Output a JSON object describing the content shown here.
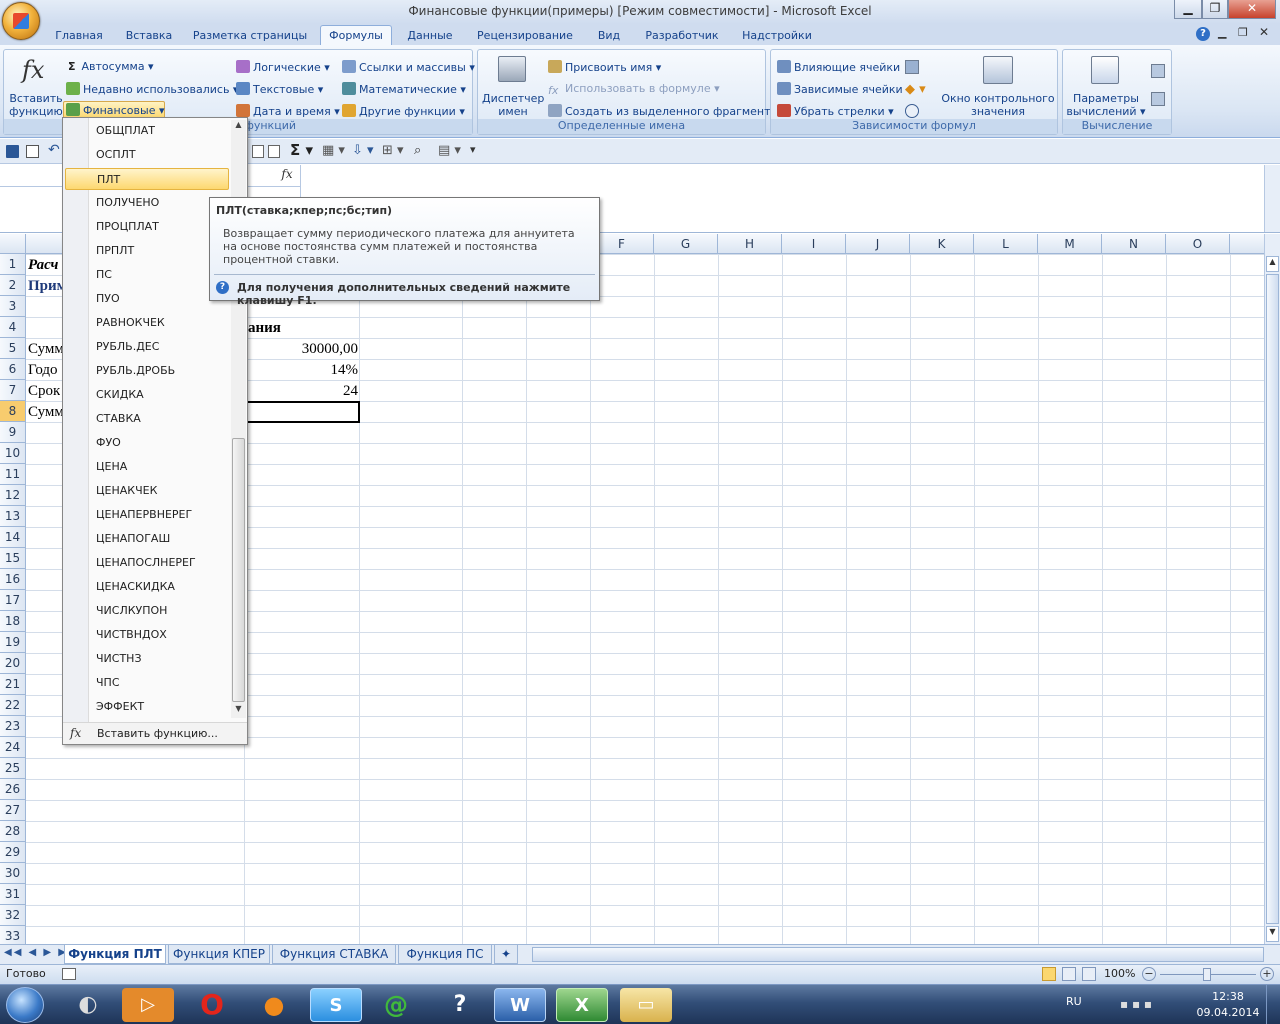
{
  "window": {
    "title": "Финансовые функции(примеры)  [Режим совместимости] - Microsoft Excel"
  },
  "ribbon_tabs": [
    "Главная",
    "Вставка",
    "Разметка страницы",
    "Формулы",
    "Данные",
    "Рецензирование",
    "Вид",
    "Разработчик",
    "Надстройки"
  ],
  "ribbon": {
    "insert_function": "Вставить функцию",
    "autosum": "Автосумма",
    "recent": "Недавно использовались",
    "financial": "Финансовые",
    "logical": "Логические",
    "text": "Текстовые",
    "datetime": "Дата и время",
    "lookup": "Ссылки и массивы",
    "math": "Математические",
    "other": "Другие функции",
    "library_label": "функций",
    "name_manager": "Диспетчер имен",
    "define_name": "Присвоить имя",
    "use_in_formula": "Использовать в формуле",
    "create_from_selection": "Создать из выделенного фрагмента",
    "defined_names_label": "Определенные имена",
    "trace_precedents": "Влияющие ячейки",
    "trace_dependents": "Зависимые ячейки",
    "remove_arrows": "Убрать стрелки",
    "watch_window": "Окно контрольного значения",
    "formula_auditing_label": "Зависимости формул",
    "calc_options": "Параметры вычислений",
    "calculation_label": "Вычисление"
  },
  "formula_bar": {
    "fx": "fx"
  },
  "columns": [
    "F",
    "G",
    "H",
    "I",
    "J",
    "K",
    "L",
    "M",
    "N",
    "O"
  ],
  "rows": [
    "1",
    "2",
    "3",
    "4",
    "5",
    "6",
    "7",
    "8",
    "9",
    "10",
    "11",
    "12",
    "13",
    "14",
    "15",
    "16",
    "17",
    "18",
    "19",
    "20",
    "21",
    "22",
    "23",
    "24",
    "25",
    "26",
    "27",
    "28",
    "29",
    "30",
    "31",
    "32",
    "33"
  ],
  "cells": {
    "a1": "Расч",
    "a2": "Прим",
    "d4": "ания",
    "a5": "Сумм",
    "c5": "30000,00",
    "a6": "Годо",
    "c6": "14%",
    "a7": "Срок",
    "c7": "24",
    "a8": "Сумм"
  },
  "financial_menu": {
    "items": [
      "ОБЩПЛАТ",
      "ОСПЛТ",
      "ПЛТ",
      "ПОЛУЧЕНО",
      "ПРОЦПЛАТ",
      "ПРПЛТ",
      "ПС",
      "ПУО",
      "РАВНОКЧЕК",
      "РУБЛЬ.ДЕС",
      "РУБЛЬ.ДРОБЬ",
      "СКИДКА",
      "СТАВКА",
      "ФУО",
      "ЦЕНА",
      "ЦЕНАКЧЕК",
      "ЦЕНАПЕРВНЕРЕГ",
      "ЦЕНАПОГАШ",
      "ЦЕНАПОСЛНЕРЕГ",
      "ЦЕНАСКИДКА",
      "ЧИСЛКУПОН",
      "ЧИСТВНДОХ",
      "ЧИСТНЗ",
      "ЧПС",
      "ЭФФЕКТ"
    ],
    "footer": "Вставить функцию..."
  },
  "tooltip": {
    "title": "ПЛТ(ставка;кпер;пс;бс;тип)",
    "body": "Возвращает сумму периодического платежа для аннуитета на основе постоянства сумм платежей и постоянства процентной ставки.",
    "help": "Для получения дополнительных сведений нажмите клавишу F1."
  },
  "sheets": [
    "Функция ПЛТ",
    "Функция КПЕР",
    "Функция СТАВКА",
    "Функция ПС"
  ],
  "status": {
    "ready": "Готово",
    "zoom": "100%"
  },
  "tray": {
    "lang": "RU",
    "time": "12:38",
    "date": "09.04.2014"
  },
  "taskbar_icons": [
    "start-orb-icon",
    "speaker-icon",
    "media-player-icon",
    "opera-icon",
    "firefox-icon",
    "skype-icon",
    "mail-agent-icon",
    "help-icon",
    "word-icon",
    "excel-icon",
    "explorer-icon"
  ]
}
